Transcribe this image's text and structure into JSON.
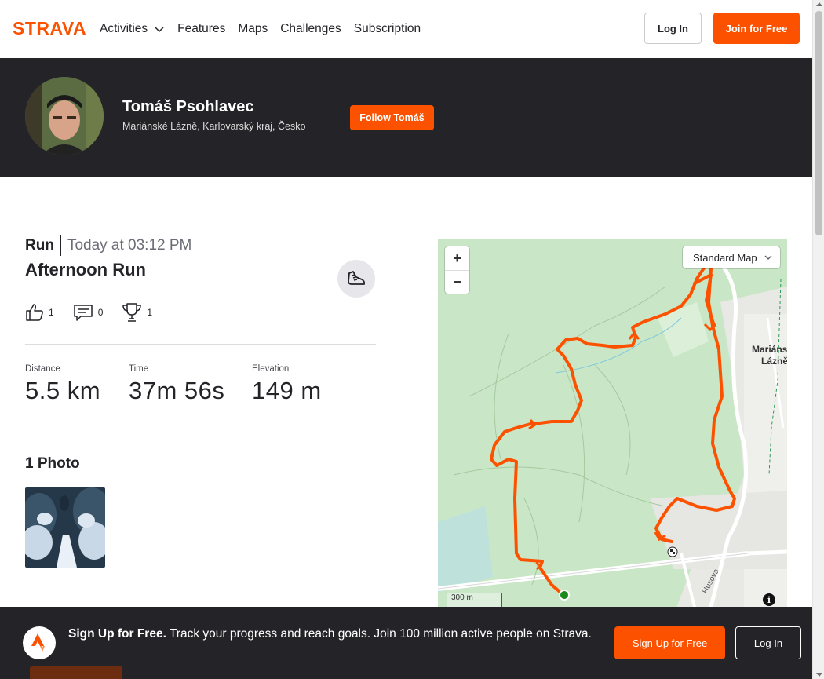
{
  "nav": {
    "brand": "STRAVA",
    "links": [
      "Activities",
      "Features",
      "Maps",
      "Challenges",
      "Subscription"
    ],
    "login": "Log In",
    "join": "Join for Free"
  },
  "athlete": {
    "name": "Tomáš Psohlavec",
    "location": "Mariánské Lázně, Karlovarský kraj, Česko",
    "follow": "Follow Tomáš"
  },
  "activity": {
    "type": "Run",
    "time": "Today at 03:12 PM",
    "title": "Afternoon Run",
    "kudos": "1",
    "comments": "0",
    "achievements": "1",
    "stats": [
      {
        "label": "Distance",
        "value": "5.5 km"
      },
      {
        "label": "Time",
        "value": "37m 56s"
      },
      {
        "label": "Elevation",
        "value": "149 m"
      }
    ],
    "photos_title": "1 Photo"
  },
  "map": {
    "zoom_in": "+",
    "zoom_out": "−",
    "style": "Standard Map",
    "scale": "300 m",
    "place_label_1": "Mariáns",
    "place_label_2": "Lázně",
    "street": "Husova",
    "info": "i",
    "route_color": "#fc5200",
    "start_color": "#1a8a1a"
  },
  "signup": {
    "headline": "Sign Up for Free.",
    "body": " Track your progress and reach goals. Join 100 million active people on Strava.",
    "signup_btn": "Sign Up for Free",
    "login_btn": "Log In"
  },
  "colors": {
    "accent": "#fc5200",
    "banner": "#242428"
  }
}
